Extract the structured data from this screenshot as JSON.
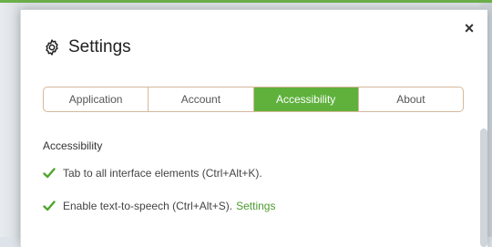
{
  "dialog": {
    "title": "Settings",
    "close_label": "×"
  },
  "tabs": [
    {
      "label": "Application",
      "active": false
    },
    {
      "label": "Account",
      "active": false
    },
    {
      "label": "Accessibility",
      "active": true
    },
    {
      "label": "About",
      "active": false
    }
  ],
  "section": {
    "title": "Accessibility",
    "options": [
      {
        "label": "Tab to all interface elements (Ctrl+Alt+K).",
        "checked": true
      },
      {
        "label": "Enable text-to-speech (Ctrl+Alt+S).",
        "checked": true,
        "link": "Settings"
      }
    ]
  },
  "colors": {
    "accent": "#5fb13c",
    "tab_border": "#d7b89a",
    "link": "#4b9a2e"
  },
  "icons": {
    "title": "gear-icon",
    "close": "close-icon",
    "checkbox": "checkmark-icon"
  }
}
